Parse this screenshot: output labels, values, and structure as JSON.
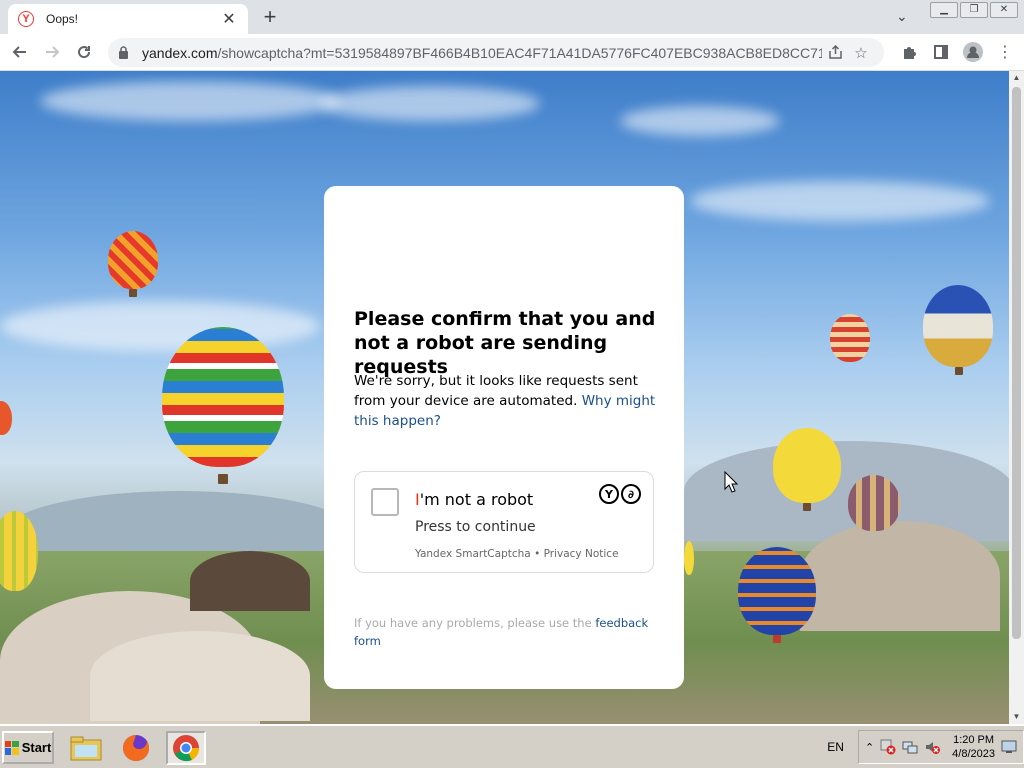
{
  "browser": {
    "tab_title": "Oops!",
    "tab_favicon_letter": "Y",
    "url_host": "yandex.com",
    "url_path": "/showcaptcha?mt=5319584897BF466B4B10EAC4F71A41DA5776FC407EBC938ACB8ED8CC714..."
  },
  "captcha": {
    "heading": "Please confirm that you and not a robot are sending requests",
    "description": "We're sorry, but it looks like requests sent from your device are automated.",
    "why_link": "Why might this happen?",
    "checkbox_label_first": "I",
    "checkbox_label_rest": "'m not a robot",
    "checkbox_sub": "Press to continue",
    "brand_text": "Yandex SmartCaptcha",
    "separator": "•",
    "privacy_link": "Privacy Notice",
    "problems_text": "If you have any problems, please use the",
    "feedback_link": "feedback form"
  },
  "taskbar": {
    "start_label": "Start",
    "language": "EN",
    "time": "1:20 PM",
    "date": "4/8/2023"
  },
  "colors": {
    "link": "#1a4f8f",
    "accent_red": "#e8340f"
  }
}
